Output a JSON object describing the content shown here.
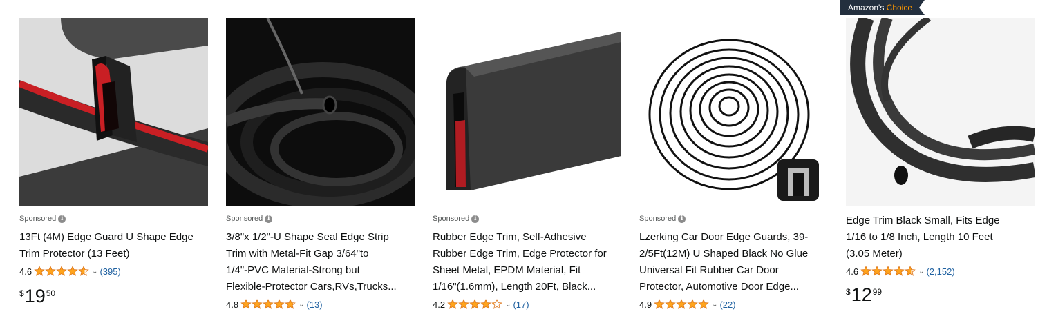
{
  "sponsored_label": "Sponsored",
  "badge": {
    "prefix": "Amazon's",
    "suffix": "Choice"
  },
  "colors": {
    "link": "#2162a1",
    "star": "#ffa41c",
    "badge_bg": "#232f3e",
    "badge_accent": "#ff9900"
  },
  "products": [
    {
      "title_lines": [
        "13Ft (4M) Edge Guard U Shape Edge",
        "Trim Protector (13 Feet)"
      ],
      "sponsored": true,
      "rating": "4.6",
      "rating_value": 4.6,
      "review_count": "(395)",
      "price": {
        "symbol": "$",
        "whole": "19",
        "fraction": "50"
      }
    },
    {
      "title_lines": [
        "3/8\"x 1/2\"-U Shape Seal Edge Strip",
        "Trim with Metal-Fit Gap 3/64\"to",
        "1/4\"-PVC Material-Strong but",
        "Flexible-Protector Cars,RVs,Trucks..."
      ],
      "sponsored": true,
      "rating": "4.8",
      "rating_value": 4.8,
      "review_count": "(13)"
    },
    {
      "title_lines": [
        "Rubber Edge Trim, Self-Adhesive",
        "Rubber Edge Trim, Edge Protector for",
        "Sheet Metal, EPDM Material, Fit",
        "1/16\"(1.6mm), Length 20Ft, Black..."
      ],
      "sponsored": true,
      "rating": "4.2",
      "rating_value": 4.2,
      "review_count": "(17)"
    },
    {
      "title_lines": [
        "Lzerking Car Door Edge Guards, 39-",
        "2/5Ft(12M) U Shaped Black No Glue",
        "Universal Fit Rubber Car Door",
        "Protector, Automotive Door Edge..."
      ],
      "sponsored": true,
      "rating": "4.9",
      "rating_value": 4.9,
      "review_count": "(22)"
    },
    {
      "title_lines": [
        "Edge Trim Black Small, Fits Edge",
        "1/16 to 1/8 Inch, Length 10 Feet",
        "(3.05 Meter)"
      ],
      "sponsored": false,
      "rating": "4.6",
      "rating_value": 4.6,
      "review_count": "(2,152)",
      "price": {
        "symbol": "$",
        "whole": "12",
        "fraction": "99"
      }
    }
  ]
}
